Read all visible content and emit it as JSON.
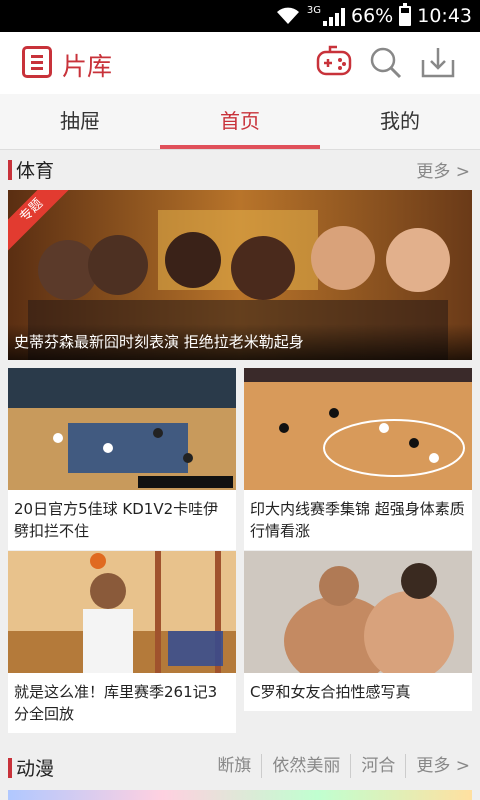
{
  "status_bar": {
    "network": "3G",
    "battery": "66%",
    "time": "10:43"
  },
  "app_bar": {
    "title": "片库",
    "icons": [
      "menu-list-icon",
      "gamepad-icon",
      "search-icon",
      "download-icon"
    ]
  },
  "tabs": [
    {
      "label": "抽屉",
      "active": false
    },
    {
      "label": "首页",
      "active": true
    },
    {
      "label": "我的",
      "active": false
    }
  ],
  "sections": {
    "sports": {
      "title": "体育",
      "more": "更多 >",
      "featured": {
        "badge": "专题",
        "caption": "史蒂芬森最新囧时刻表演 拒绝拉老米勒起身"
      },
      "items": [
        {
          "title": "20日官方5佳球 KD1V2卡哇伊劈扣拦不住"
        },
        {
          "title": "印大内线赛季集锦 超强身体素质行情看涨"
        },
        {
          "title": "就是这么准！库里赛季261记3分全回放"
        },
        {
          "title": "C罗和女友合拍性感写真"
        }
      ]
    },
    "anime": {
      "title": "动漫",
      "tags": [
        "断旗",
        "依然美丽",
        "河合",
        "更多 >"
      ]
    }
  },
  "colors": {
    "accent": "#c8323a",
    "tab_underline": "#e0505a",
    "background": "#efefef"
  }
}
